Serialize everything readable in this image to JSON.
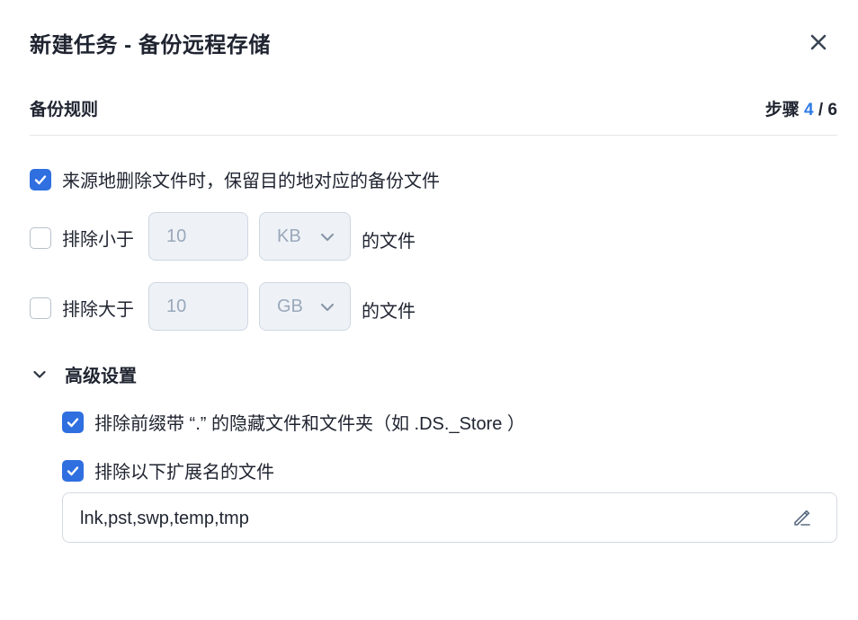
{
  "dialog": {
    "title": "新建任务 - 备份远程存储"
  },
  "section": {
    "title": "备份规则",
    "step_prefix": "步骤 ",
    "step_current": "4",
    "step_sep": " / ",
    "step_total": "6"
  },
  "options": {
    "keep_deleted": {
      "label": "来源地删除文件时，保留目的地对应的备份文件",
      "checked": true
    },
    "exclude_smaller": {
      "label": "排除小于",
      "checked": false,
      "value": "10",
      "unit": "KB",
      "suffix": "的文件"
    },
    "exclude_larger": {
      "label": "排除大于",
      "checked": false,
      "value": "10",
      "unit": "GB",
      "suffix": "的文件"
    }
  },
  "advanced": {
    "title": "高级设置",
    "expanded": true,
    "exclude_hidden": {
      "label": "排除前缀带 “.” 的隐藏文件和文件夹（如 .DS._Store ）",
      "checked": true
    },
    "exclude_ext": {
      "label": "排除以下扩展名的文件",
      "checked": true,
      "value": "lnk,pst,swp,temp,tmp"
    }
  },
  "icons": {
    "close": "close-icon",
    "check": "check-icon",
    "chevron_down": "chevron-down-icon",
    "edit": "pencil-icon"
  },
  "colors": {
    "accent": "#2f6fe0",
    "step_highlight": "#2f7be6",
    "disabled_bg": "#eef2f7",
    "disabled_text": "#9aa8ba"
  }
}
